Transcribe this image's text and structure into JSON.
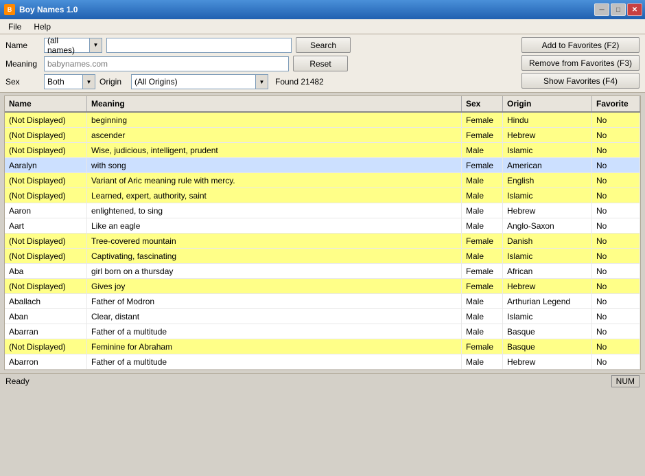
{
  "window": {
    "title": "Boy Names 1.0",
    "minimize_label": "─",
    "maximize_label": "□",
    "close_label": "✕"
  },
  "menu": {
    "items": [
      {
        "label": "File"
      },
      {
        "label": "Help"
      }
    ]
  },
  "toolbar": {
    "name_label": "Name",
    "name_combo_value": "(all names)",
    "name_input_placeholder": "",
    "meaning_label": "Meaning",
    "meaning_input_placeholder": "babynames.com",
    "sex_label": "Sex",
    "sex_combo_value": "Both",
    "origin_label": "Origin",
    "origin_combo_value": "(All Origins)",
    "found_text": "Found 21482",
    "search_btn": "Search",
    "reset_btn": "Reset",
    "add_favorites_btn": "Add to Favorites (F2)",
    "remove_favorites_btn": "Remove from Favorites (F3)",
    "show_favorites_btn": "Show Favorites (F4)"
  },
  "table": {
    "columns": [
      {
        "label": "Name",
        "key": "name"
      },
      {
        "label": "Meaning",
        "key": "meaning"
      },
      {
        "label": "Sex",
        "key": "sex"
      },
      {
        "label": "Origin",
        "key": "origin"
      },
      {
        "label": "Favorite",
        "key": "favorite"
      }
    ],
    "rows": [
      {
        "name": "(Not Displayed)",
        "meaning": "beginning",
        "sex": "Female",
        "origin": "Hindu",
        "favorite": "No",
        "highlighted": true
      },
      {
        "name": "(Not Displayed)",
        "meaning": "ascender",
        "sex": "Female",
        "origin": "Hebrew",
        "favorite": "No",
        "highlighted": true
      },
      {
        "name": "(Not Displayed)",
        "meaning": "Wise, judicious, intelligent, prudent",
        "sex": "Male",
        "origin": "Islamic",
        "favorite": "No",
        "highlighted": true
      },
      {
        "name": "Aaralyn",
        "meaning": "with song",
        "sex": "Female",
        "origin": "American",
        "favorite": "No",
        "highlighted": false,
        "selected": true
      },
      {
        "name": "(Not Displayed)",
        "meaning": "Variant of Aric meaning rule with mercy.",
        "sex": "Male",
        "origin": "English",
        "favorite": "No",
        "highlighted": true
      },
      {
        "name": "(Not Displayed)",
        "meaning": "Learned, expert, authority, saint",
        "sex": "Male",
        "origin": "Islamic",
        "favorite": "No",
        "highlighted": true
      },
      {
        "name": "Aaron",
        "meaning": "enlightened, to sing",
        "sex": "Male",
        "origin": "Hebrew",
        "favorite": "No",
        "highlighted": false
      },
      {
        "name": "Aart",
        "meaning": "Like an eagle",
        "sex": "Male",
        "origin": "Anglo-Saxon",
        "favorite": "No",
        "highlighted": false
      },
      {
        "name": "(Not Displayed)",
        "meaning": "Tree-covered mountain",
        "sex": "Female",
        "origin": "Danish",
        "favorite": "No",
        "highlighted": true
      },
      {
        "name": "(Not Displayed)",
        "meaning": "Captivating, fascinating",
        "sex": "Male",
        "origin": "Islamic",
        "favorite": "No",
        "highlighted": true
      },
      {
        "name": "Aba",
        "meaning": "girl born on a thursday",
        "sex": "Female",
        "origin": "African",
        "favorite": "No",
        "highlighted": false
      },
      {
        "name": "(Not Displayed)",
        "meaning": "Gives joy",
        "sex": "Female",
        "origin": "Hebrew",
        "favorite": "No",
        "highlighted": true
      },
      {
        "name": "Aballach",
        "meaning": "Father of Modron",
        "sex": "Male",
        "origin": "Arthurian Legend",
        "favorite": "No",
        "highlighted": false
      },
      {
        "name": "Aban",
        "meaning": "Clear, distant",
        "sex": "Male",
        "origin": "Islamic",
        "favorite": "No",
        "highlighted": false
      },
      {
        "name": "Abarran",
        "meaning": "Father of a multitude",
        "sex": "Male",
        "origin": "Basque",
        "favorite": "No",
        "highlighted": false
      },
      {
        "name": "(Not Displayed)",
        "meaning": "Feminine for Abraham",
        "sex": "Female",
        "origin": "Basque",
        "favorite": "No",
        "highlighted": true
      },
      {
        "name": "Abarron",
        "meaning": "Father of a multitude",
        "sex": "Male",
        "origin": "Hebrew",
        "favorite": "No",
        "highlighted": false
      }
    ]
  },
  "status": {
    "text": "Ready",
    "num_indicator": "NUM"
  }
}
